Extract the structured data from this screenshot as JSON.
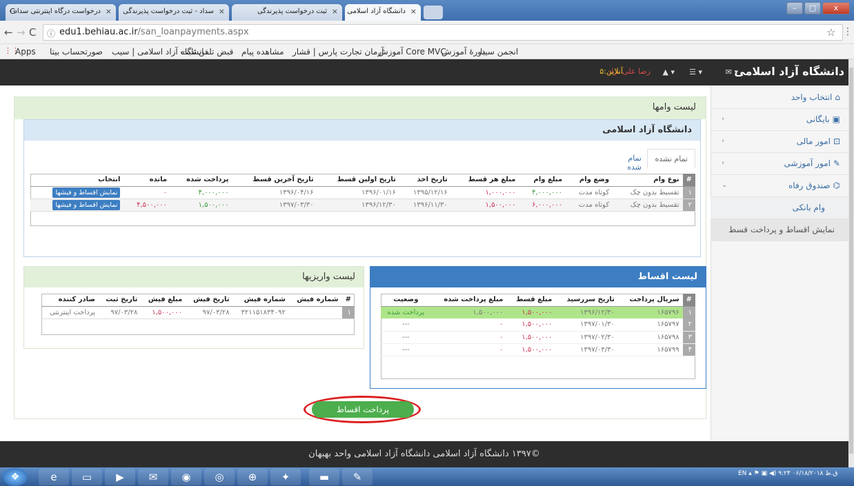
{
  "browser": {
    "tabs": [
      {
        "title": "درخواست درگاه اینترنتی سداد -"
      },
      {
        "title": "سداد - ثبت درخواست پذیرندگی"
      },
      {
        "title": "ثبت درخواست پذیرندگی"
      },
      {
        "title": "دانشگاه آزاد اسلامی"
      }
    ],
    "url_host": "edu1.behiau.ac.ir",
    "url_path": "/san_loanpayments.aspx",
    "bookmarks": [
      "Apps",
      "صورتحساب بیتا",
      "دانشگاه آزاد اسلامی | سیب",
      "قبض تلفن ثابت",
      "مشاهده پیام",
      "آرمان تجارت پارس | قشار",
      "Core MVC آموزش",
      "دورهٔ آموزش",
      "انجمن سیبا"
    ]
  },
  "header": {
    "brand": "دانشگاه آزاد اسلامی",
    "user": "رضا علی نژاد",
    "online": "آنلاین:۵"
  },
  "sidebar": {
    "items": [
      {
        "label": "انتخاب واحد",
        "icon": "home-icon"
      },
      {
        "label": "بایگانی",
        "icon": "archive-icon"
      },
      {
        "label": "امور مالی",
        "icon": "money-icon"
      },
      {
        "label": "امور آموزشی",
        "icon": "pencil-icon"
      },
      {
        "label": "صندوق رفاه",
        "icon": "bank-icon"
      },
      {
        "label": "وام بانکی"
      },
      {
        "label": "نمایش اقساط و پرداخت قسط"
      }
    ]
  },
  "main": {
    "title": "لیست وامها",
    "university": "دانشگاه آزاد اسلامی",
    "tabs": [
      "تمام نشده",
      "تمام شده"
    ],
    "loans": {
      "headers": [
        "#",
        "نوع وام",
        "وضع وام",
        "مبلغ وام",
        "مبلغ هر قسط",
        "تاریخ اخذ",
        "تاریخ اولین قسط",
        "تاریخ آخرین قسط",
        "پرداخت شده",
        "مانده",
        "انتخاب"
      ],
      "rows": [
        [
          "۱",
          "تقسیط بدون چک",
          "کوتاه مدت",
          "۴,۰۰۰,۰۰۰",
          "۱,۰۰۰,۰۰۰",
          "۱۳۹۵/۱۲/۱۶",
          "۱۳۹۶/۰۱/۱۶",
          "۱۳۹۶/۰۴/۱۶",
          "۴,۰۰۰,۰۰۰",
          "۰",
          "نمایش اقساط و فیشها"
        ],
        [
          "۲",
          "تقسیط بدون چک",
          "کوتاه مدت",
          "۶,۰۰۰,۰۰۰",
          "۱,۵۰۰,۰۰۰",
          "۱۳۹۶/۱۱/۳۰",
          "۱۳۹۶/۱۲/۳۰",
          "۱۳۹۷/۰۳/۳۰",
          "۱,۵۰۰,۰۰۰",
          "۴,۵۰۰,۰۰۰",
          "نمایش اقساط و فیشها"
        ]
      ]
    },
    "installments": {
      "title": "لیست اقساط",
      "headers": [
        "#",
        "سریال پرداخت",
        "تاریخ سررسید",
        "مبلغ قسط",
        "مبلغ پرداخت شده",
        "وضعیت"
      ],
      "rows": [
        [
          "۱",
          "۱۶۵۷۹۶",
          "۱۳۹۶/۱۲/۳۰",
          "۱,۵۰۰,۰۰۰",
          "۱,۵۰۰,۰۰۰",
          "پرداخت شده"
        ],
        [
          "۲",
          "۱۶۵۷۹۷",
          "۱۳۹۷/۰۱/۳۰",
          "۱,۵۰۰,۰۰۰",
          "۰",
          "---"
        ],
        [
          "۳",
          "۱۶۵۷۹۸",
          "۱۳۹۷/۰۲/۳۰",
          "۱,۵۰۰,۰۰۰",
          "۰",
          "---"
        ],
        [
          "۴",
          "۱۶۵۷۹۹",
          "۱۳۹۷/۰۳/۳۰",
          "۱,۵۰۰,۰۰۰",
          "۰",
          "---"
        ]
      ]
    },
    "deposits": {
      "title": "لیست واریزیها",
      "headers": [
        "#",
        "شماره فیش",
        "شماره فیش",
        "تاریخ فیش",
        "مبلغ فیش",
        "تاریخ ثبت",
        "صادر کننده"
      ],
      "rows": [
        [
          "۱",
          "",
          "۳۲۱۱۵۱۸۳۴۰۹۲",
          "۹۷/۰۳/۲۸",
          "۱,۵۰۰,۰۰۰",
          "۹۷/۰۳/۲۸",
          "پرداخت اینترنتی"
        ]
      ]
    },
    "pay_button": "پرداخت اقساط"
  },
  "footer": "©۱۳۹۷ دانشگاه آزاد اسلامی دانشگاه آزاد اسلامی واحد بهبهان",
  "taskbar": {
    "lang": "EN",
    "time": "۹:۲۴ ق.ظ",
    "date": "۰۶/۱۸/۲۰۱۸"
  }
}
